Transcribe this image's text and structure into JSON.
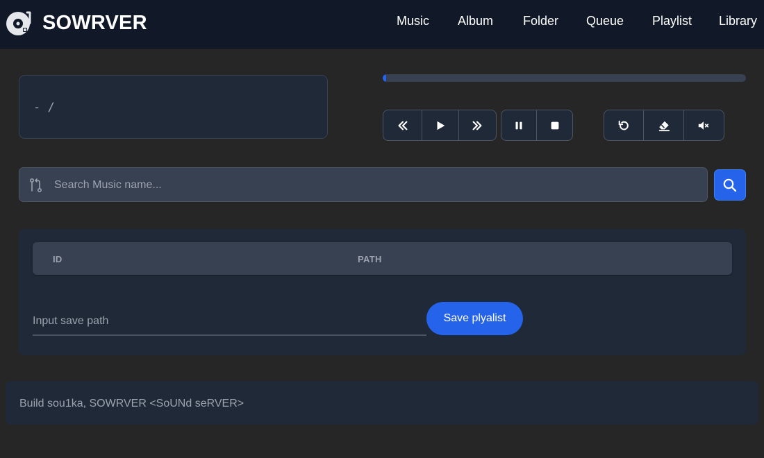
{
  "app": {
    "name": "SOWRVER",
    "logo_icon": "turntable-icon"
  },
  "nav": {
    "items": [
      "Music",
      "Album",
      "Folder",
      "Queue",
      "Playlist",
      "Library"
    ]
  },
  "now_playing": {
    "text": "- /"
  },
  "progress": {
    "value_percent": 1
  },
  "controls": {
    "transport": [
      "rewind-icon",
      "play-icon",
      "fast-forward-icon"
    ],
    "playback": [
      "pause-icon",
      "stop-icon"
    ],
    "queue": [
      "repeat-icon",
      "eraser-icon",
      "mute-icon"
    ]
  },
  "search": {
    "placeholder": "Search Music name...",
    "value": "",
    "icon": "git-compare-icon",
    "button_icon": "search-icon"
  },
  "table": {
    "columns": [
      "ID",
      "PATH"
    ],
    "rows": []
  },
  "save": {
    "placeholder": "Input save path",
    "value": "",
    "button_label": "Save plyalist"
  },
  "footer": {
    "text": "Build sou1ka, SOWRVER <SoUNd seRVER>"
  },
  "colors": {
    "accent": "#2563eb",
    "navbar_bg": "#111827",
    "page_bg": "#262626",
    "card_bg": "#1f2937"
  }
}
